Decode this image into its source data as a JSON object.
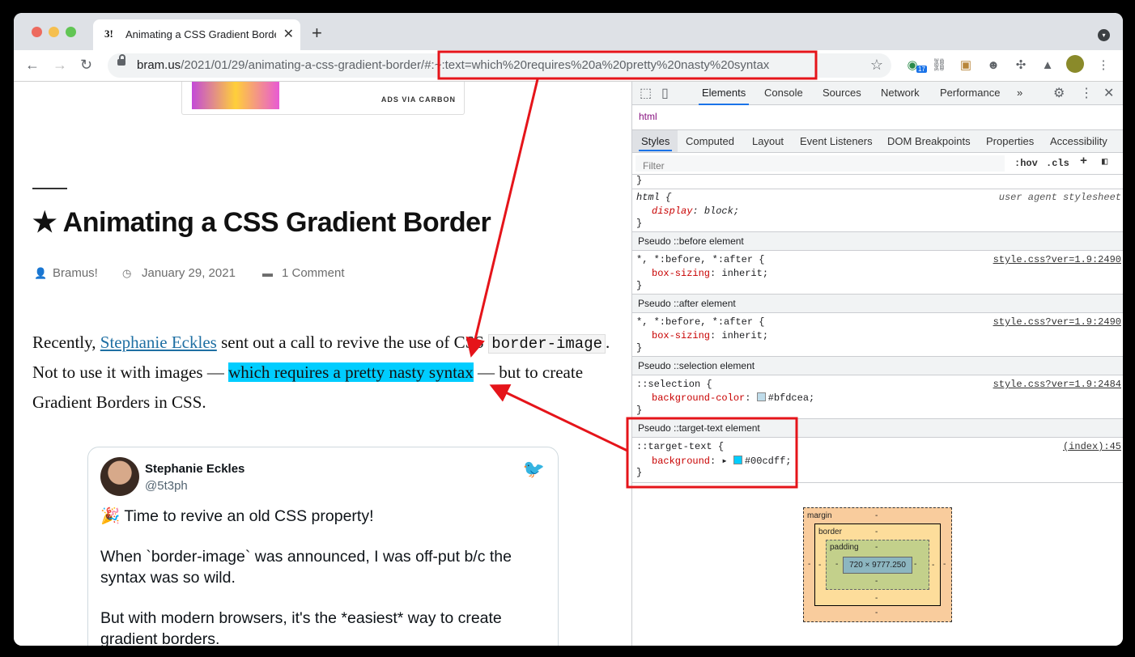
{
  "browser": {
    "tab_favicon": "3!",
    "tab_title": "Animating a CSS Gradient Border",
    "tab_close": "✕",
    "new_tab": "+",
    "url_host": "bram.us",
    "url_path": "/2021/01/29/animating-a-css-gradient-border",
    "url_fragment": "/#:~:text=which%20requires%20a%20pretty%20nasty%20syntax",
    "extension_badge": "17"
  },
  "page": {
    "ad_label": "ADS VIA CARBON",
    "title": "Animating a CSS Gradient Border",
    "author": "Bramus!",
    "date": "January 29, 2021",
    "comments": "1 Comment",
    "para": {
      "part1": "Recently, ",
      "link": "Stephanie Eckles",
      "part2": " sent out a call to revive the use of CSS ",
      "code": "border-image",
      "part3": ". Not to use it with images — ",
      "highlight": "which requires a pretty nasty syntax",
      "part4": " — but to create Gradient Borders in CSS."
    },
    "tweet": {
      "name": "Stephanie Eckles",
      "handle": "@5t3ph",
      "line1": "🎉 Time to revive an old CSS property!",
      "line2": "When `border-image` was announced, I was off-put b/c the syntax was so wild.",
      "line3": "But with modern browsers, it's the *easiest* way to create gradient borders."
    }
  },
  "devtools": {
    "tabs": [
      "Elements",
      "Console",
      "Sources",
      "Network",
      "Performance",
      "»"
    ],
    "breadcrumb": "html",
    "subtabs": [
      "Styles",
      "Computed",
      "Layout",
      "Event Listeners",
      "DOM Breakpoints",
      "Properties",
      "Accessibility"
    ],
    "filter_placeholder": "Filter",
    "hov": ":hov",
    "cls": ".cls",
    "plus": "+",
    "rules": {
      "stray_brace": "}",
      "html_selector": "html {",
      "html_source": "user agent stylesheet",
      "html_prop": "display",
      "html_val": ": block;",
      "close": "}",
      "before_header": "Pseudo ::before element",
      "after_header": "Pseudo ::after element",
      "selection_header": "Pseudo ::selection element",
      "target_header": "Pseudo ::target-text element",
      "universal_selector": "*, *:before, *:after {",
      "box_sizing_prop": "box-sizing",
      "box_sizing_val": ": inherit;",
      "src_2490": "style.css?ver=1.9:2490",
      "src_2484": "style.css?ver=1.9:2484",
      "selection_selector": "::selection {",
      "selection_prop": "background-color",
      "selection_val": "#bfdcea;",
      "target_selector": "::target-text {",
      "target_prop": "background",
      "target_val": "#00cdff;",
      "target_src": "(index):45"
    },
    "box_model": {
      "margin_label": "margin",
      "border_label": "border",
      "padding_label": "padding",
      "content_size": "720 × 9777.250",
      "dash": "-"
    },
    "colors": {
      "selection_swatch": "#bfdcea",
      "target_swatch": "#00cdff"
    }
  }
}
